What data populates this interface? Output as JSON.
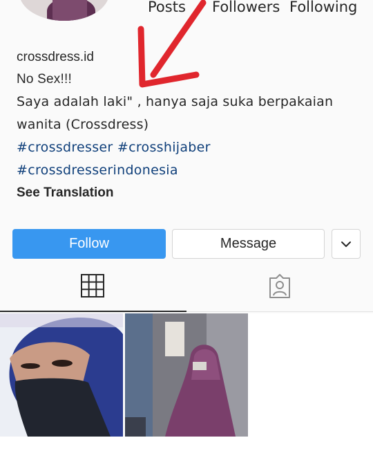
{
  "profile": {
    "stats": {
      "posts_label": "Posts",
      "followers_label": "Followers",
      "following_label": "Following"
    },
    "username": "crossdress.id",
    "bio": {
      "line1": "No Sex!!!",
      "line2": "Saya adalah laki\" , hanya saja suka berpakaian",
      "line3": "wanita (Crossdress)",
      "hashtags_line1": "#crossdresser #crosshijaber",
      "hashtags_line2": "#crossdresserindonesia"
    },
    "see_translation": "See Translation"
  },
  "actions": {
    "follow_label": "Follow",
    "message_label": "Message",
    "more_icon": "chevron-down-icon"
  },
  "tabs": {
    "grid_icon": "grid-icon",
    "tagged_icon": "tagged-icon",
    "active": "grid"
  },
  "colors": {
    "follow_button": "#3897f0",
    "hashtag": "#0f3f7a",
    "annotation_arrow": "#e0262d"
  }
}
